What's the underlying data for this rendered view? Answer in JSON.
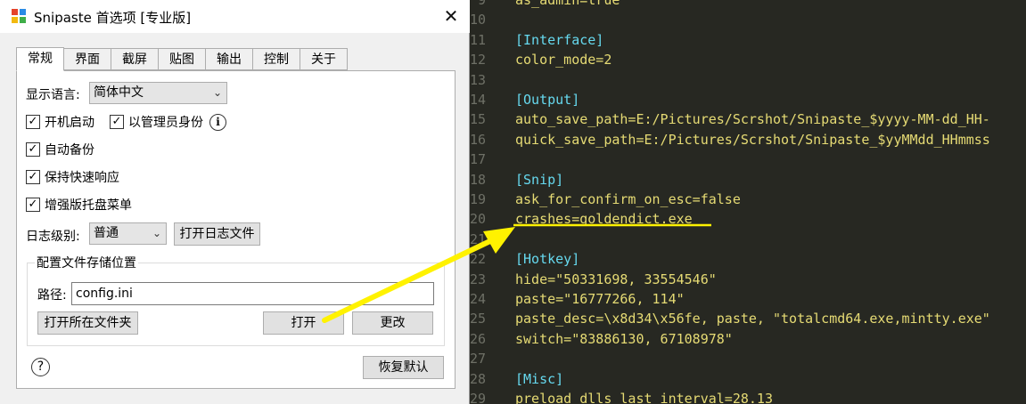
{
  "dialog": {
    "title": "Snipaste 首选项 [专业版]",
    "close_glyph": "✕",
    "tabs": [
      "常规",
      "界面",
      "截屏",
      "贴图",
      "输出",
      "控制",
      "关于"
    ],
    "active_tab": "常规",
    "language_label": "显示语言:",
    "language_value": "简体中文",
    "checkboxes": {
      "autostart": "开机启动",
      "run_as_admin": "以管理员身份",
      "auto_backup": "自动备份",
      "keep_responsive": "保持快速响应",
      "enhanced_tray_menu": "增强版托盘菜单"
    },
    "check_glyph": "✓",
    "info_glyph": "i",
    "log_level_label": "日志级别:",
    "log_level_value": "普通",
    "open_log_file_button": "打开日志文件",
    "config_group_title": "配置文件存储位置",
    "path_label": "路径:",
    "path_value": "config.ini",
    "open_folder_button": "打开所在文件夹",
    "open_button": "打开",
    "change_button": "更改",
    "help_glyph": "?",
    "restore_defaults_button": "恢复默认",
    "dropdown_glyph": "⌄"
  },
  "editor": {
    "lines": [
      {
        "num": "9",
        "text": "as_admin=true"
      },
      {
        "num": "10",
        "text": ""
      },
      {
        "num": "11",
        "text": "[Interface]"
      },
      {
        "num": "12",
        "text": "color_mode=2"
      },
      {
        "num": "13",
        "text": ""
      },
      {
        "num": "14",
        "text": "[Output]"
      },
      {
        "num": "15",
        "text": "auto_save_path=E:/Pictures/Scrshot/Snipaste_$yyyy-MM-dd_HH-"
      },
      {
        "num": "16",
        "text": "quick_save_path=E:/Pictures/Scrshot/Snipaste_$yyMMdd_HHmmss"
      },
      {
        "num": "17",
        "text": ""
      },
      {
        "num": "18",
        "text": "[Snip]"
      },
      {
        "num": "19",
        "text": "ask_for_confirm_on_esc=false"
      },
      {
        "num": "20",
        "text": "crashes=goldendict.exe"
      },
      {
        "num": "21",
        "text": ""
      },
      {
        "num": "22",
        "text": "[Hotkey]"
      },
      {
        "num": "23",
        "text": "hide=\"50331698, 33554546\""
      },
      {
        "num": "24",
        "text": "paste=\"16777266, 114\""
      },
      {
        "num": "25",
        "text": "paste_desc=\\x8d34\\x56fe, paste, \"totalcmd64.exe,mintty.exe\""
      },
      {
        "num": "26",
        "text": "switch=\"83886130, 67108978\""
      },
      {
        "num": "27",
        "text": ""
      },
      {
        "num": "28",
        "text": "[Misc]"
      },
      {
        "num": "29",
        "text": "preload_dlls_last_interval=28.13"
      }
    ]
  },
  "annotation": {
    "color": "#fff200"
  }
}
